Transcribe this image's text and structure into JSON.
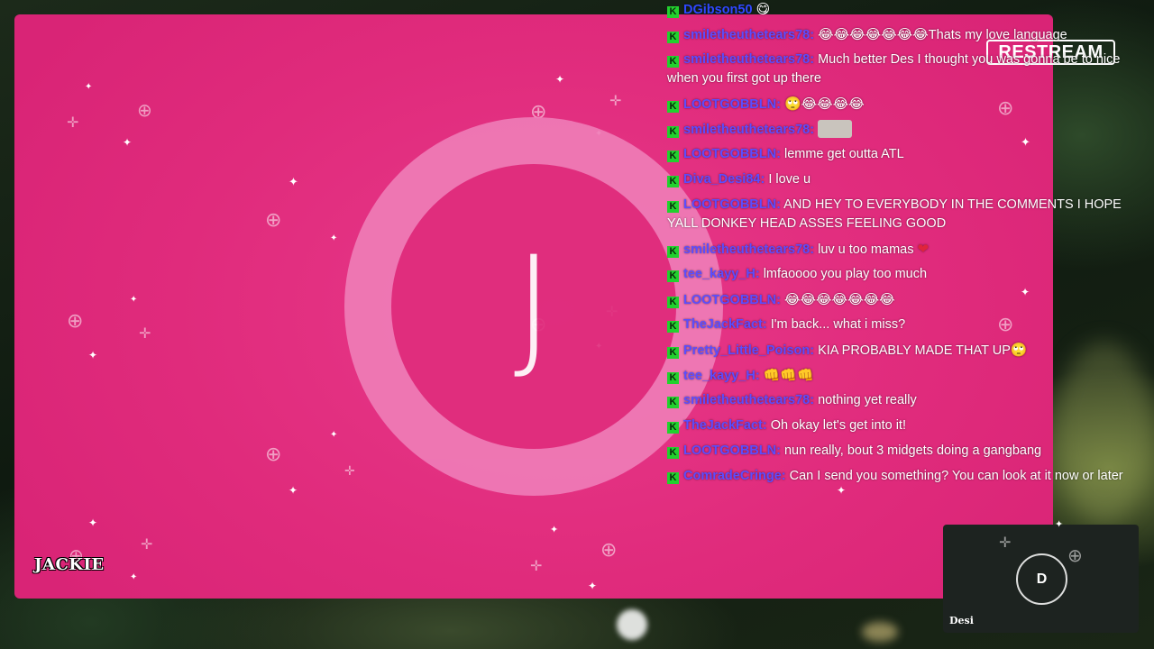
{
  "stage": {
    "avatar_letter": "J",
    "name_tag": "JACKIE"
  },
  "logo": {
    "text": "RESTREAM"
  },
  "chat": {
    "badge_letter": "K",
    "messages": [
      {
        "user": "DGibson50",
        "text": "",
        "emoji": "😋"
      },
      {
        "user": "smiletheuthetears78:",
        "text": "Thats my love language",
        "emoji": "😂😂😂😂😂😂😂"
      },
      {
        "user": "smiletheuthetears78:",
        "text": "Much better Des I thought you was gonna be to nice when you first got up there",
        "emoji": ""
      },
      {
        "user": "LOOTGOBBLN:",
        "text": "",
        "emoji": "🙄😂😂😂😂"
      },
      {
        "user": "smiletheuthetears78:",
        "text": "",
        "emoji": ""
      },
      {
        "user": "LOOTGOBBLN:",
        "text": "lemme get outta ATL",
        "emoji": ""
      },
      {
        "user": "Diva_Desi84:",
        "text": "I love u",
        "emoji": ""
      },
      {
        "user": "LOOTGOBBLN:",
        "text": "AND HEY TO EVERYBODY IN THE COMMENTS I HOPE YALL DONKEY HEAD ASSES FEELING GOOD",
        "emoji": ""
      },
      {
        "user": "smiletheuthetears78:",
        "text": "luv u too mamas",
        "emoji": "❤"
      },
      {
        "user": "tee_kayy_H:",
        "text": "lmfaoooo you play too much",
        "emoji": ""
      },
      {
        "user": "LOOTGOBBLN:",
        "text": "",
        "emoji": "😂😂😂😂😂😂😂"
      },
      {
        "user": "TheJackFact:",
        "text": "I'm back... what i miss?",
        "emoji": ""
      },
      {
        "user": "Pretty_Little_Poison:",
        "text": "KIA PROBABLY MADE THAT UP",
        "emoji": "🙄"
      },
      {
        "user": "tee_kayy_H:",
        "text": "",
        "emoji": "👊👊👊"
      },
      {
        "user": "smiletheuthetears78:",
        "text": "nothing yet really",
        "emoji": ""
      },
      {
        "user": "TheJackFact:",
        "text": "Oh okay let's get into it!",
        "emoji": ""
      },
      {
        "user": "LOOTGOBBLN:",
        "text": "nun really, bout 3 midgets doing a gangbang",
        "emoji": ""
      },
      {
        "user": "ComradeCringe:",
        "text": "Can I send you something? You can look at it now or later",
        "emoji": ""
      }
    ]
  },
  "tile": {
    "avatar_letter": "D",
    "name": "Desi"
  },
  "colors": {
    "stage_pink": "#e02b7c",
    "ring_pink": "#ef7cb7",
    "kick_green": "#22d12e",
    "username_blue": "#5b4dff"
  }
}
